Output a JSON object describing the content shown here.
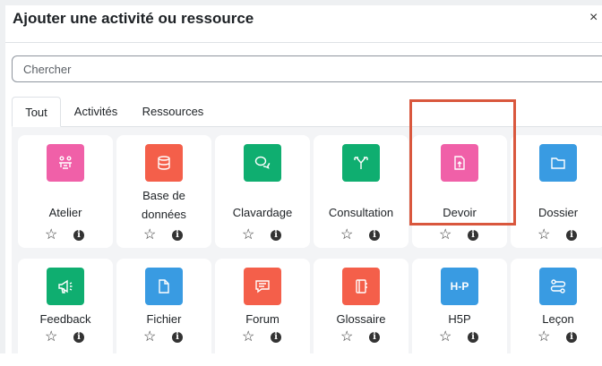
{
  "dialog": {
    "title": "Ajouter une activité ou ressource",
    "close_symbol": "×"
  },
  "search": {
    "placeholder": "Chercher",
    "value": ""
  },
  "tabs": [
    {
      "label": "Tout",
      "active": true
    },
    {
      "label": "Activités",
      "active": false
    },
    {
      "label": "Ressources",
      "active": false
    }
  ],
  "modules": [
    {
      "name": "Atelier",
      "icon": "workshop-icon",
      "color": "#f060a8"
    },
    {
      "name": "Base de\ndonnées",
      "icon": "database-icon",
      "color": "#f45f4a"
    },
    {
      "name": "Clavardage",
      "icon": "chat-icon",
      "color": "#0fae70"
    },
    {
      "name": "Consultation",
      "icon": "choice-icon",
      "color": "#0fae70"
    },
    {
      "name": "Devoir",
      "icon": "assignment-icon",
      "color": "#f060a8",
      "highlighted": true
    },
    {
      "name": "Dossier",
      "icon": "folder-icon",
      "color": "#399be2"
    },
    {
      "name": "Feedback",
      "icon": "feedback-icon",
      "color": "#0fae70"
    },
    {
      "name": "Fichier",
      "icon": "file-icon",
      "color": "#399be2"
    },
    {
      "name": "Forum",
      "icon": "forum-icon",
      "color": "#f45f4a"
    },
    {
      "name": "Glossaire",
      "icon": "glossary-icon",
      "color": "#f45f4a"
    },
    {
      "name": "H5P",
      "icon": "h5p-icon",
      "color": "#399be2",
      "icon_text": "H-P"
    },
    {
      "name": "Leçon",
      "icon": "lesson-icon",
      "color": "#399be2"
    }
  ],
  "card_actions": {
    "star_symbol": "☆",
    "info_symbol": "i"
  },
  "highlight_color": "#d9573d"
}
